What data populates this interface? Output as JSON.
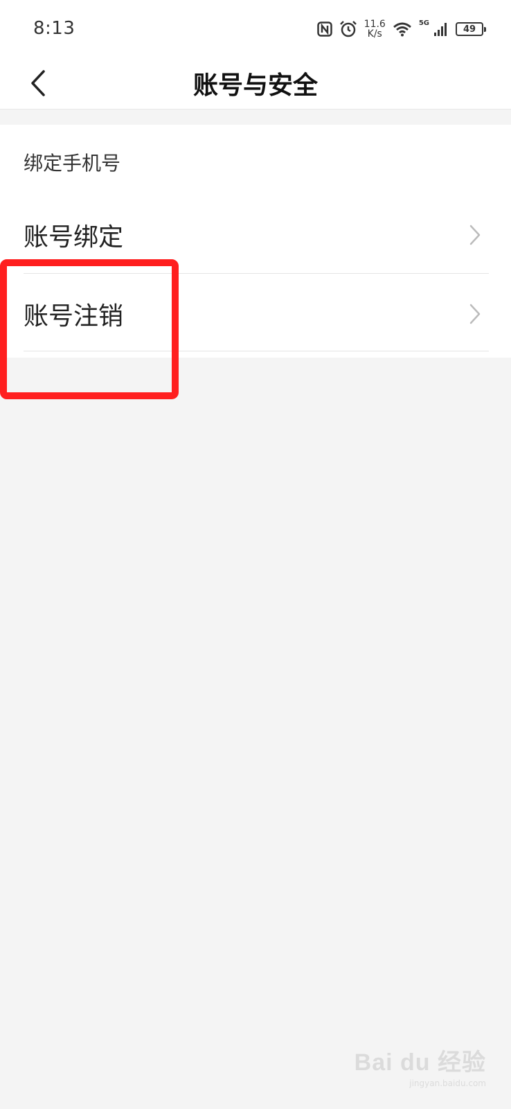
{
  "status_bar": {
    "time": "8:13",
    "net_speed_value": "11.6",
    "net_speed_unit": "K/s",
    "signal_label": "5G",
    "battery_level": "49"
  },
  "nav": {
    "back_icon": "chevron-left-icon",
    "title": "账号与安全"
  },
  "settings": {
    "section_label": "绑定手机号",
    "items": [
      {
        "label": "账号绑定",
        "icon": "chevron-right-icon"
      },
      {
        "label": "账号注销",
        "icon": "chevron-right-icon"
      }
    ]
  },
  "annotation": {
    "highlight_color": "#ff1f1f",
    "target": "账号注销"
  },
  "watermark": {
    "mark": "Bai du 经验",
    "sub": "jingyan.baidu.com"
  },
  "colors": {
    "background": "#f4f4f4",
    "surface": "#ffffff",
    "text_primary": "#222222",
    "chevron": "#bbbbbb"
  }
}
